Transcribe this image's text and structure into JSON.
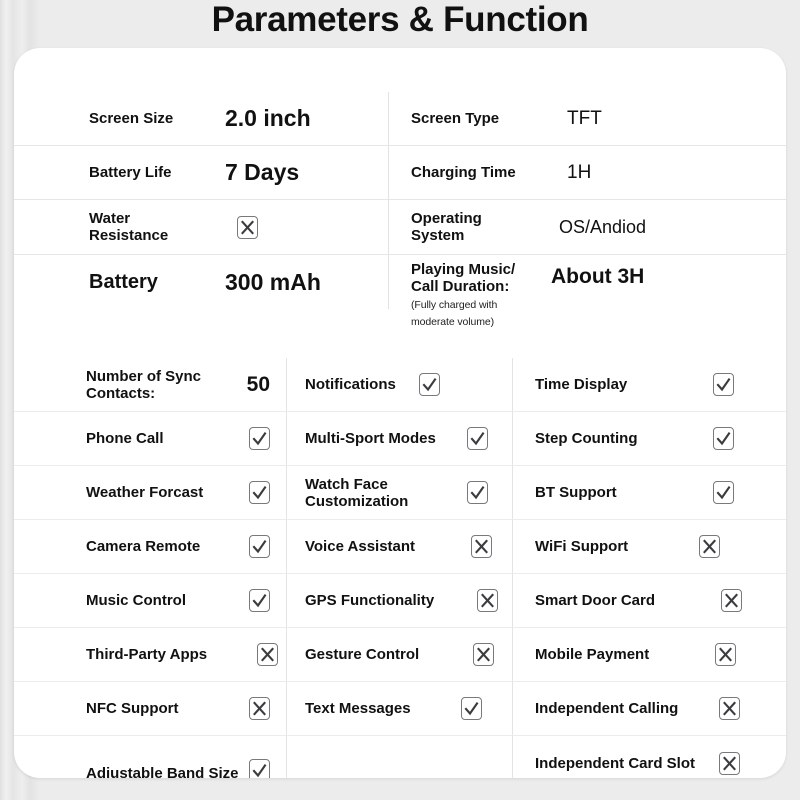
{
  "header": {
    "title": "Parameters & Function"
  },
  "specs": [
    {
      "left": {
        "label": "Screen Size",
        "value": "2.0 inch",
        "style": "bold"
      },
      "right": {
        "label": "Screen Type",
        "value": "TFT",
        "style": "regular"
      }
    },
    {
      "left": {
        "label": "Battery Life",
        "value": "7 Days",
        "style": "bold"
      },
      "right": {
        "label": "Charging Time",
        "value": "1H",
        "style": "regular"
      }
    },
    {
      "left": {
        "label": "Water Resistance",
        "value": "",
        "mark": "x"
      },
      "right": {
        "label": "Operating System",
        "value": "OS/Andiod",
        "style": "regular"
      }
    },
    {
      "left": {
        "label": "Battery",
        "value": "300 mAh",
        "style": "bold"
      },
      "right": {
        "label": "Playing Music/ Call Duration:",
        "note": "(Fully charged with moderate volume)",
        "value": "About 3H",
        "style": "bold-small"
      }
    }
  ],
  "features": [
    [
      {
        "label": "Number of Sync Contacts:",
        "value": "50"
      },
      {
        "label": "Notifications",
        "mark": "check"
      },
      {
        "label": "Time Display",
        "mark": "check"
      }
    ],
    [
      {
        "label": "Phone Call",
        "mark": "check"
      },
      {
        "label": "Multi-Sport Modes",
        "mark": "check"
      },
      {
        "label": "Step Counting",
        "mark": "check"
      }
    ],
    [
      {
        "label": "Weather Forcast",
        "mark": "check"
      },
      {
        "label": "Watch Face Customization",
        "mark": "check"
      },
      {
        "label": "BT Support",
        "mark": "check"
      }
    ],
    [
      {
        "label": "Camera Remote",
        "mark": "check"
      },
      {
        "label": "Voice Assistant",
        "mark": "x"
      },
      {
        "label": "WiFi Support",
        "mark": "x"
      }
    ],
    [
      {
        "label": "Music Control",
        "mark": "check"
      },
      {
        "label": "GPS Functionality",
        "mark": "x"
      },
      {
        "label": "Smart Door Card",
        "mark": "x"
      }
    ],
    [
      {
        "label": "Third-Party Apps",
        "mark": "x"
      },
      {
        "label": "Gesture Control",
        "mark": "x"
      },
      {
        "label": "Mobile Payment",
        "mark": "x"
      }
    ],
    [
      {
        "label": "NFC Support",
        "mark": "x"
      },
      {
        "label": "Text Messages",
        "mark": "check"
      },
      {
        "label": "Independent Calling",
        "mark": "x"
      }
    ],
    [
      {
        "label": "Adjustable Band Size",
        "mark": "check"
      },
      {
        "label": "",
        "mark": "none"
      },
      {
        "label": "Independent Card Slot",
        "mark": "x"
      }
    ]
  ],
  "icons": {
    "check": "check-icon",
    "x": "x-icon"
  },
  "colors": {
    "text": "#111111",
    "rule": "#ececec",
    "box_border": "#77797b",
    "card": "#ffffff",
    "page_bg": "#e9e9e9"
  }
}
